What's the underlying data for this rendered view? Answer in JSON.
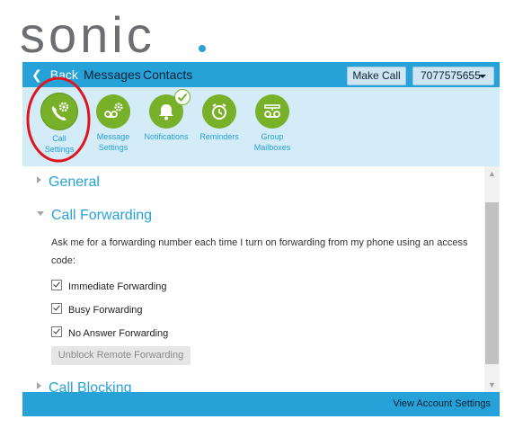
{
  "brand": {
    "logo_text": "sonic.",
    "dot_color": "#27a2d8",
    "letter_color": "#6d6e71"
  },
  "nav": {
    "back_label": "Back",
    "messages_label": "Messages",
    "contacts_label": "Contacts",
    "make_call_label": "Make Call",
    "phone_number": "7077575655"
  },
  "toolbar": {
    "items": [
      {
        "label_line1": "Call",
        "label_line2": "Settings",
        "icon": "phone-gear-icon",
        "active": true
      },
      {
        "label_line1": "Message",
        "label_line2": "Settings",
        "icon": "voicemail-gear-icon"
      },
      {
        "label_line1": "Notifications",
        "label_line2": "",
        "icon": "bell-check-icon"
      },
      {
        "label_line1": "Reminders",
        "label_line2": "",
        "icon": "alarm-clock-icon"
      },
      {
        "label_line1": "Group",
        "label_line2": "Mailboxes",
        "icon": "group-voicemail-icon"
      }
    ]
  },
  "content": {
    "general_title": "General",
    "call_forwarding_title": "Call Forwarding",
    "description": "Ask me for a forwarding number each time I turn on forwarding from my phone using an access code:",
    "options": [
      {
        "label": "Immediate Forwarding",
        "checked": true
      },
      {
        "label": "Busy Forwarding",
        "checked": true
      },
      {
        "label": "No Answer Forwarding",
        "checked": true
      }
    ],
    "unblock_label": "Unblock Remote Forwarding",
    "call_blocking_title": "Call Blocking"
  },
  "footer": {
    "account_link": "View Account Settings"
  },
  "colors": {
    "accent": "#27a2d8",
    "green": "#78b02a",
    "toolbar_bg": "#d3ecf7",
    "annotation_red": "#e0141e"
  }
}
